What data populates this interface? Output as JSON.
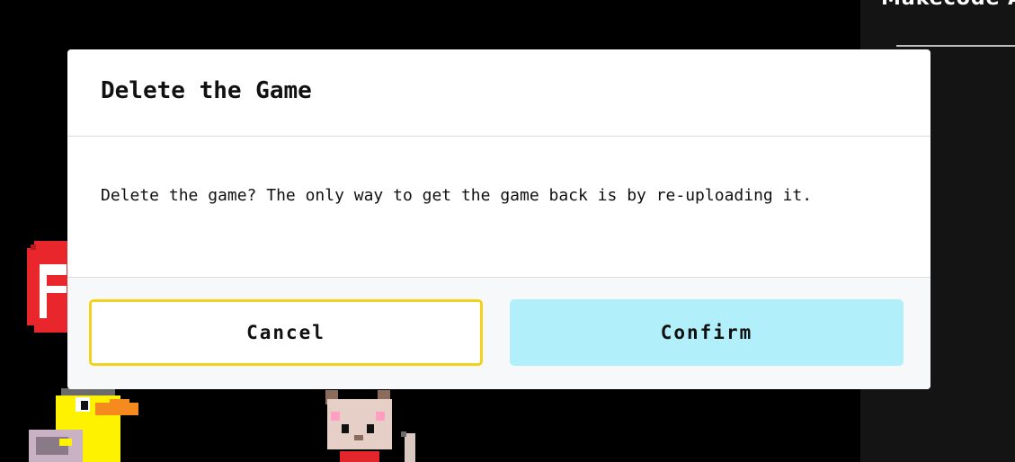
{
  "background": {
    "side_panel_title": "Makecode Ar"
  },
  "dialog": {
    "title": "Delete the Game",
    "message": "Delete the game? The only way to get the game back is by re-uploading it.",
    "cancel_label": "Cancel",
    "confirm_label": "Confirm"
  },
  "colors": {
    "backdrop": "#000000",
    "cancel_focus_border": "#f2d21b",
    "confirm_fill": "#b1effa",
    "footer_bg": "#f7f8fa"
  },
  "icons": [
    "arcade-logo-icon",
    "duck-sprite-icon",
    "cat-sprite-icon"
  ]
}
